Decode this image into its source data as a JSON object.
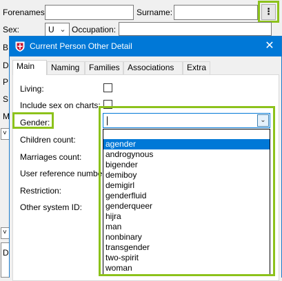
{
  "background_window": {
    "forenames_label": "Forenames:",
    "surname_label": "Surname:",
    "more_button": "⋮",
    "sex_label": "Sex:",
    "sex_value": "U",
    "occupation_label": "Occupation:",
    "left_letters": [
      "B",
      "D",
      "P",
      "S",
      "M",
      "D"
    ],
    "collapse_arrows": [
      "˅",
      "˅"
    ]
  },
  "dialog": {
    "title": "Current Person Other Detail",
    "close_glyph": "✕",
    "tabs": [
      "Main",
      "Naming",
      "Families",
      "Associations",
      "Extra"
    ],
    "active_tab": "Main",
    "fields": {
      "living": "Living:",
      "include_sex": "Include sex on charts:",
      "gender": "Gender:",
      "children_count": "Children count:",
      "marriages_count": "Marriages count:",
      "user_reference": "User reference number:",
      "restriction": "Restriction:",
      "other_system_id": "Other system ID:"
    },
    "gender_value": "",
    "gender_options": [
      "agender",
      "androgynous",
      "bigender",
      "demiboy",
      "demigirl",
      "genderfluid",
      "genderqueer",
      "hijra",
      "man",
      "nonbinary",
      "transgender",
      "two-spirit",
      "woman"
    ],
    "selected_option": "agender"
  }
}
